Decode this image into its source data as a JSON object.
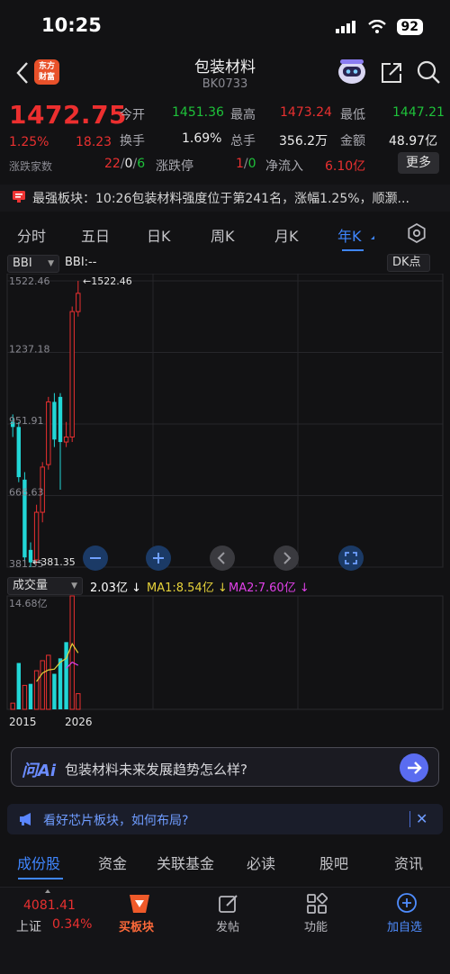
{
  "status": {
    "time": "10:25",
    "battery": "92"
  },
  "header": {
    "title": "包装材料",
    "code": "BK0733",
    "logo_line1": "东方",
    "logo_line2": "财富"
  },
  "quote": {
    "price": "1472.75",
    "change_pct": "1.25%",
    "change": "18.23",
    "up_down_label": "涨跌家数",
    "up": "22",
    "flat": "0",
    "down": "6",
    "open_label": "今开",
    "open": "1451.36",
    "high_label": "最高",
    "high": "1473.24",
    "low_label": "最低",
    "low": "1447.21",
    "turnover_label": "换手",
    "turnover": "1.69%",
    "volume_label": "总手",
    "volume": "356.2万",
    "amount_label": "金额",
    "amount": "48.97亿",
    "limit_label": "涨跌停",
    "limit_up": "1",
    "limit_down": "0",
    "netflow_label": "净流入",
    "netflow": "6.10亿",
    "more_label": "更多"
  },
  "banner": {
    "text": "最强板块：10:26包装材料强度位于第241名，涨幅1.25%，顺灏..."
  },
  "period_tabs": [
    "分时",
    "五日",
    "日K",
    "周K",
    "月K",
    "年K"
  ],
  "chart_header": {
    "indicator": "BBI",
    "indicator_value": "BBI:--",
    "dk_label": "DK点"
  },
  "chart_data": {
    "type": "candlestick",
    "y_ticks": [
      "1522.46",
      "1237.18",
      "951.91",
      "666.63",
      "381.35"
    ],
    "ylim": [
      381.35,
      1522.46
    ],
    "max_label": "1522.46",
    "min_label": "381.35",
    "x_labels": [
      "2015",
      "2026"
    ],
    "candles": [
      {
        "o": 960,
        "c": 940,
        "h": 990,
        "l": 900,
        "dir": "down"
      },
      {
        "o": 940,
        "c": 740,
        "h": 960,
        "l": 720,
        "dir": "down"
      },
      {
        "o": 730,
        "c": 420,
        "h": 760,
        "l": 400,
        "dir": "down"
      },
      {
        "o": 450,
        "c": 400,
        "h": 480,
        "l": 381.35,
        "dir": "down"
      },
      {
        "o": 410,
        "c": 600,
        "h": 630,
        "l": 395,
        "dir": "up"
      },
      {
        "o": 600,
        "c": 780,
        "h": 800,
        "l": 560,
        "dir": "up"
      },
      {
        "o": 790,
        "c": 1040,
        "h": 1060,
        "l": 770,
        "dir": "up"
      },
      {
        "o": 1040,
        "c": 890,
        "h": 1075,
        "l": 860,
        "dir": "down"
      },
      {
        "o": 1060,
        "c": 880,
        "h": 1075,
        "l": 690,
        "dir": "down"
      },
      {
        "o": 880,
        "c": 900,
        "h": 960,
        "l": 860,
        "dir": "up"
      },
      {
        "o": 900,
        "c": 1400,
        "h": 1420,
        "l": 880,
        "dir": "up"
      },
      {
        "o": 1400,
        "c": 1472.75,
        "h": 1522.46,
        "l": 1380,
        "dir": "up"
      }
    ],
    "volume": {
      "label": "成交量",
      "value": "2.03亿",
      "ma1": "MA1:8.54亿",
      "ma2": "MA2:7.60亿",
      "ymax_label": "14.68亿",
      "ymax": 14.68,
      "bars": [
        {
          "v": 0.8,
          "dir": "up"
        },
        {
          "v": 6.0,
          "dir": "down"
        },
        {
          "v": 3.1,
          "dir": "up"
        },
        {
          "v": 3.3,
          "dir": "down"
        },
        {
          "v": 5.0,
          "dir": "up"
        },
        {
          "v": 6.3,
          "dir": "up"
        },
        {
          "v": 7.0,
          "dir": "up"
        },
        {
          "v": 4.6,
          "dir": "down"
        },
        {
          "v": 6.6,
          "dir": "down"
        },
        {
          "v": 8.7,
          "dir": "down"
        },
        {
          "v": 14.68,
          "dir": "up"
        },
        {
          "v": 2.03,
          "dir": "up"
        }
      ],
      "ma1_series": [
        null,
        null,
        null,
        null,
        3.6,
        4.7,
        5.1,
        5.2,
        6.1,
        6.6,
        8.5,
        7.3
      ],
      "ma2_series": [
        null,
        null,
        null,
        null,
        null,
        null,
        null,
        null,
        null,
        5.3,
        6.1,
        5.7
      ]
    }
  },
  "ai": {
    "logo": "问Ai",
    "prompt": "包装材料未来发展趋势怎么样?"
  },
  "promo": {
    "text": "看好芯片板块，如何布局?"
  },
  "bottom_tabs": [
    "成份股",
    "资金",
    "关联基金",
    "必读",
    "股吧",
    "资讯"
  ],
  "bottom_nav": {
    "index_value": "4081.41",
    "index_name": "上证",
    "index_change": "0.34%",
    "items": [
      "买板块",
      "发帖",
      "功能",
      "加自选"
    ]
  },
  "colors": {
    "up": "#e93030",
    "down": "#22d6d6",
    "accent": "#3f86ff"
  }
}
